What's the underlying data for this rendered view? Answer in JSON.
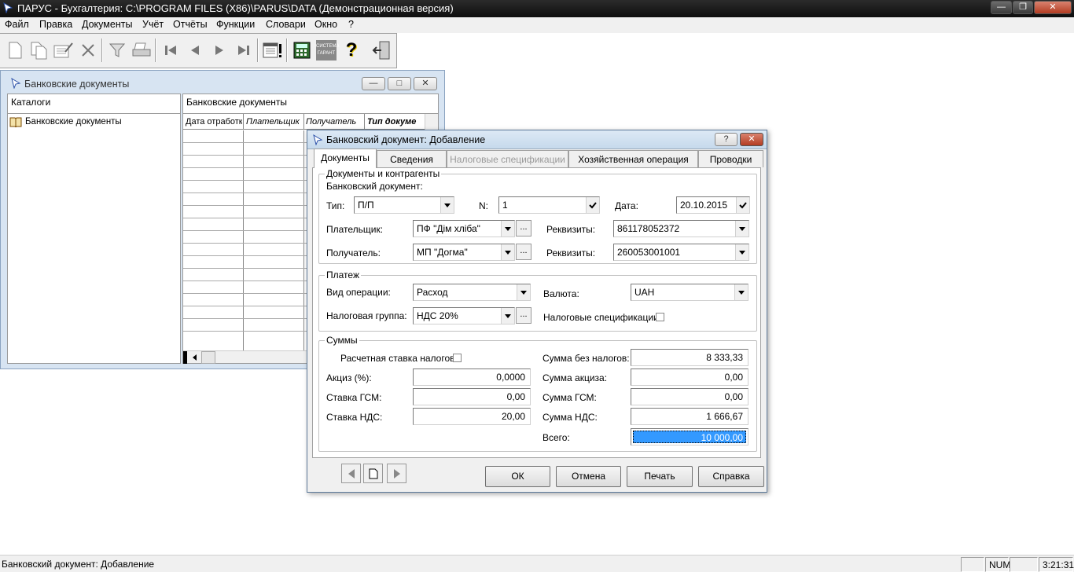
{
  "app": {
    "title": "ПАРУС - Бухгалтерия: C:\\PROGRAM FILES (X86)\\PARUS\\DATA (Демонстрационная версия)"
  },
  "menu": [
    "Файл",
    "Правка",
    "Документы",
    "Учёт",
    "Отчёты",
    "Функции",
    "Словари",
    "Окно",
    "?"
  ],
  "toolbar": {
    "icons": [
      "new-doc-icon",
      "copy-doc-icon",
      "edit-doc-icon",
      "delete-icon",
      "filter-icon",
      "print-icon",
      "first-record-icon",
      "prev-record-icon",
      "next-record-icon",
      "last-record-icon",
      "calendar-icon",
      "calculator-icon",
      "system-garant-icon",
      "help-icon",
      "exit-icon"
    ],
    "garant_text": "СИСТЕМА ГАРАНТ"
  },
  "child_window": {
    "title": "Банковские документы",
    "catalogs_header": "Каталоги",
    "catalog_item": "Банковские документы",
    "list_header": "Банковские документы",
    "columns": [
      "Дата отработк",
      "Плательщик",
      "Получатель",
      "Тип докуме"
    ]
  },
  "dialog": {
    "title": "Банковский документ: Добавление",
    "help_btn": "?",
    "tabs": [
      "Документы",
      "Сведения",
      "Налоговые спецификации",
      "Хозяйственная операция",
      "Проводки"
    ],
    "group_docs": {
      "label": "Документы и контрагенты",
      "sub_label": "Банковский документ:",
      "type_label": "Тип:",
      "type_value": "П/П",
      "n_label": "N:",
      "n_value": "1",
      "date_label": "Дата:",
      "date_value": "20.10.2015",
      "payer_label": "Плательщик:",
      "payer_value": "ПФ \"Дім хліба\"",
      "payer_req_label": "Реквизиты:",
      "payer_req_value": "861178052372",
      "recipient_label": "Получатель:",
      "recipient_value": "МП \"Догма\"",
      "recipient_req_label": "Реквизиты:",
      "recipient_req_value": "260053001001"
    },
    "group_payment": {
      "label": "Платеж",
      "op_label": "Вид операции:",
      "op_value": "Расход",
      "currency_label": "Валюта:",
      "currency_value": "UAH",
      "tax_group_label": "Налоговая группа:",
      "tax_group_value": "НДС 20%",
      "tax_spec_label": "Налоговые спецификации:"
    },
    "group_sums": {
      "label": "Суммы",
      "calc_rate_label": "Расчетная ставка налогов:",
      "excise_label": "Акциз (%):",
      "excise_value": "0,0000",
      "gsm_rate_label": "Ставка ГСМ:",
      "gsm_rate_value": "0,00",
      "vat_rate_label": "Ставка НДС:",
      "vat_rate_value": "20,00",
      "no_tax_label": "Сумма без налогов:",
      "no_tax_value": "8 333,33",
      "excise_sum_label": "Сумма акциза:",
      "excise_sum_value": "0,00",
      "gsm_sum_label": "Сумма ГСМ:",
      "gsm_sum_value": "0,00",
      "vat_sum_label": "Сумма НДС:",
      "vat_sum_value": "1 666,67",
      "total_label": "Всего:",
      "total_value": "10 000,00"
    },
    "buttons": {
      "ok": "ОК",
      "cancel": "Отмена",
      "print": "Печать",
      "help": "Справка"
    }
  },
  "status": {
    "text": "Банковский документ: Добавление",
    "num": "NUM",
    "time": "3:21:31"
  },
  "colors": {
    "selection": "#3399ff"
  }
}
